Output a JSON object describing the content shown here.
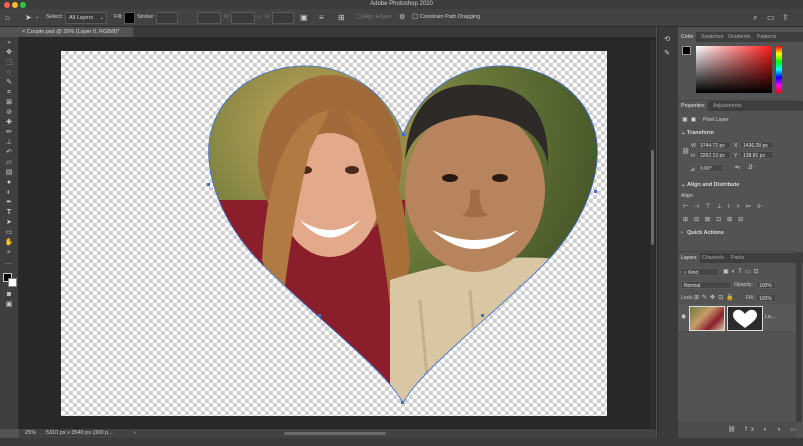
{
  "app": {
    "title": "Adobe Photoshop 2020"
  },
  "colors": {
    "traffic_red": "#ff5f57",
    "traffic_yellow": "#febc2e",
    "traffic_green": "#28c840",
    "accent_blue": "#4a90e2",
    "path_blue": "#3a6fd8"
  },
  "options_bar": {
    "select_label": "Select:",
    "select_value": "All Layers",
    "fill_label": "Fill:",
    "stroke_label": "Stroke:",
    "w_label": "W:",
    "h_label": "H:",
    "align_edges": "Align Edges",
    "constrain_path": "Constrain Path Dragging"
  },
  "document": {
    "tab_title": "Couple.psd @ 25% (Layer 0, RGB/8)",
    "tab_modified": "*"
  },
  "status_bar": {
    "zoom": "25%",
    "info": "5310 px x 3540 px (300 p..."
  },
  "color_panel": {
    "tabs": [
      "Color",
      "Swatches",
      "Gradients",
      "Patterns"
    ]
  },
  "properties_panel": {
    "tabs": [
      "Properties",
      "Adjustments"
    ],
    "layer_type": "Pixel Layer",
    "transform_title": "Transform",
    "w": "3744.72 px",
    "x": "1436.28 px",
    "h": "3262.13 px",
    "y": "138.81 px",
    "w_label": "W",
    "h_label": "H",
    "x_label": "X",
    "y_label": "Y",
    "angle": "0.00°",
    "align_title": "Align and Distribute",
    "align_label": "Align:",
    "quick_actions_title": "Quick Actions"
  },
  "layers_panel": {
    "tabs": [
      "Layers",
      "Channels",
      "Paths"
    ],
    "kind": "Kind",
    "blend_mode": "Normal",
    "opacity_label": "Opacity:",
    "opacity": "100%",
    "lock_label": "Lock:",
    "fill_label": "Fill:",
    "fill": "100%",
    "layer_name": "La..."
  },
  "tools": [
    "move",
    "marquee",
    "lasso",
    "quick-select",
    "crop",
    "frame",
    "eyedropper",
    "healing",
    "brush",
    "clone",
    "history-brush",
    "eraser",
    "gradient",
    "blur",
    "dodge",
    "pen",
    "type",
    "path-select",
    "shape",
    "hand",
    "zoom",
    "more"
  ]
}
